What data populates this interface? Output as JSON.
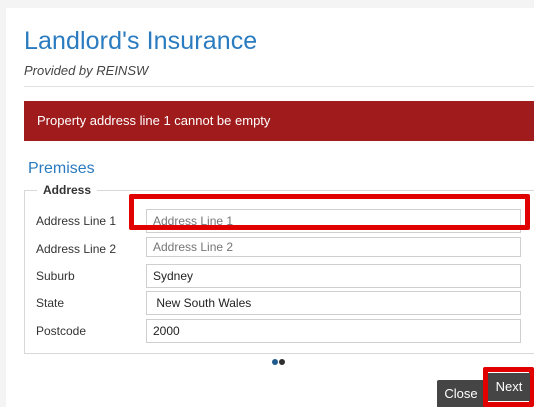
{
  "header": {
    "title": "Landlord's Insurance",
    "subtitle": "Provided by REINSW"
  },
  "error": {
    "message": "Property address line 1 cannot be empty"
  },
  "premises": {
    "section_title": "Premises",
    "legend": "Address",
    "fields": [
      {
        "label": "Address Line 1",
        "value": "",
        "placeholder": "Address Line 1"
      },
      {
        "label": "Address Line 2",
        "value": "",
        "placeholder": "Address Line 2"
      },
      {
        "label": "Suburb",
        "value": "Sydney",
        "placeholder": ""
      },
      {
        "label": "State",
        "value": " New South Wales",
        "placeholder": ""
      },
      {
        "label": "Postcode",
        "value": "2000",
        "placeholder": ""
      }
    ]
  },
  "pager": {
    "pages": 2,
    "current": 1
  },
  "footer": {
    "close_label": "Close",
    "next_label": "Next"
  },
  "colors": {
    "title": "#2a7bbf",
    "error_bg": "#a01c1c",
    "highlight": "#e00000",
    "button_bg": "#454545"
  }
}
